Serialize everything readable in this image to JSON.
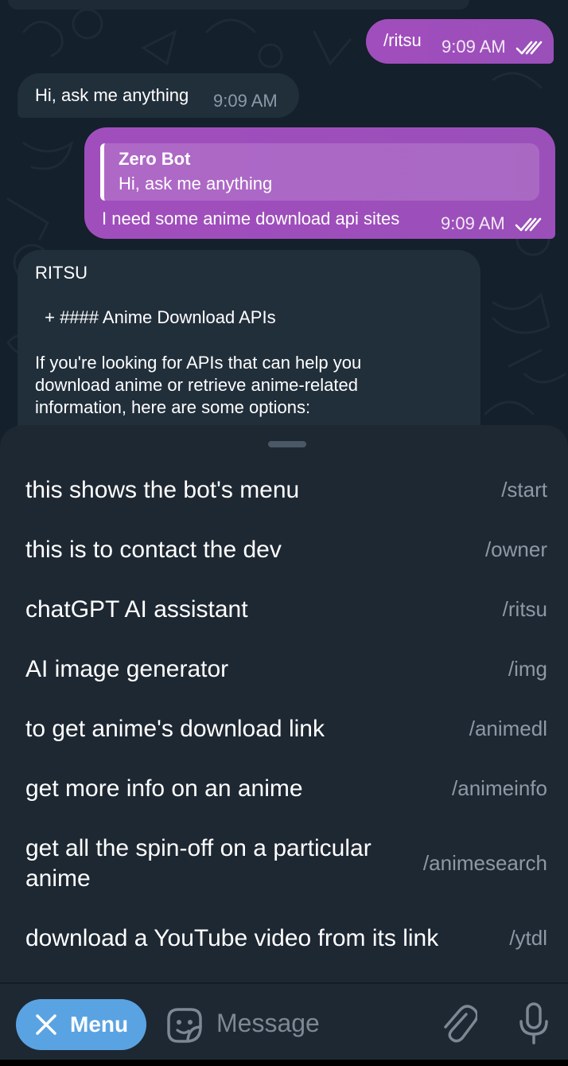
{
  "colors": {
    "chat_background": "#14202b",
    "outgoing_bubble": "#9b4fb7",
    "incoming_bubble": "#212f3b",
    "sheet_background": "#1e2833",
    "menu_button": "#5aa3e2",
    "command_name": "#8d99a5"
  },
  "messages": [
    {
      "direction": "outgoing",
      "text": "/ritsu",
      "time": "9:09 AM",
      "status_icon": "double-check-icon"
    },
    {
      "direction": "incoming",
      "text": "Hi, ask me anything",
      "time": "9:09 AM"
    },
    {
      "direction": "outgoing",
      "reply_to": {
        "name": "Zero Bot",
        "text": "Hi, ask me anything"
      },
      "text": "I need some anime download api sites",
      "time": "9:09 AM",
      "status_icon": "double-check-icon"
    },
    {
      "direction": "incoming",
      "sender": "RITSU",
      "heading": " + #### Anime Download APIs",
      "body": "If you're looking for APIs that can help you download anime or retrieve anime-related information, here are some options:"
    }
  ],
  "commands": [
    {
      "description": "this shows the bot's menu",
      "command": "/start"
    },
    {
      "description": "this is to contact the dev",
      "command": "/owner"
    },
    {
      "description": "chatGPT AI assistant",
      "command": "/ritsu"
    },
    {
      "description": "AI image generator",
      "command": "/img"
    },
    {
      "description": "to get anime's download link",
      "command": "/animedl"
    },
    {
      "description": "get more info on an anime",
      "command": "/animeinfo"
    },
    {
      "description": "get all the spin-off on a particular anime",
      "command": "/animesearch"
    },
    {
      "description": "download a YouTube video from its link",
      "command": "/ytdl"
    }
  ],
  "input_bar": {
    "menu_label": "Menu",
    "menu_icon": "close-icon",
    "placeholder": "Message",
    "icons": [
      "sticker-icon",
      "attach-icon",
      "microphone-icon"
    ]
  }
}
